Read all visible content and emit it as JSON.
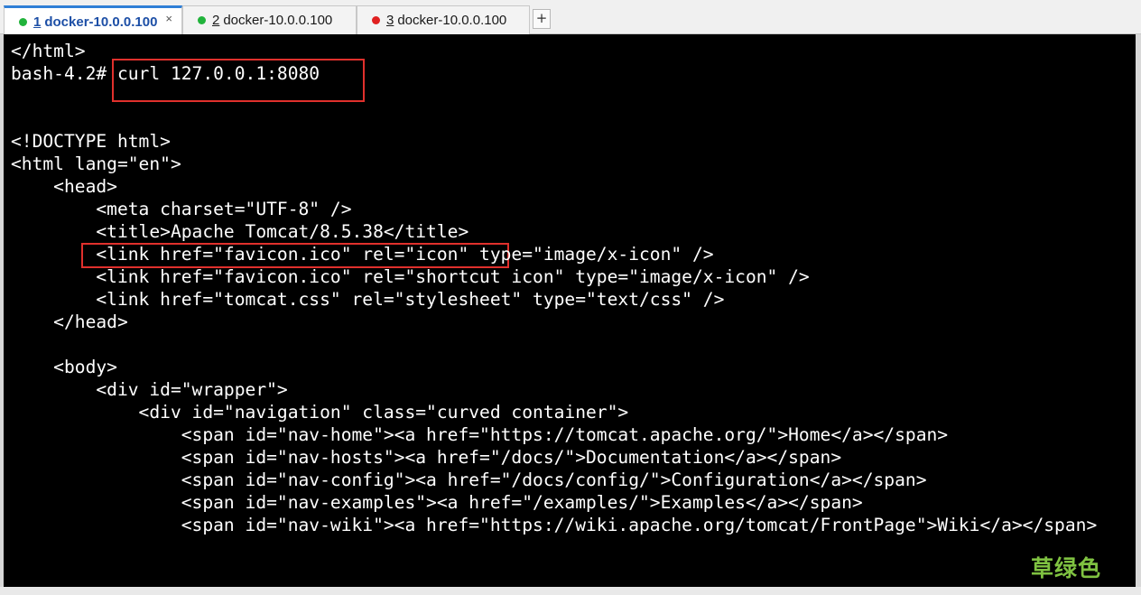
{
  "tabs": [
    {
      "num": "1",
      "label": "docker-10.0.0.100",
      "dot_color": "#21b33b",
      "active": true,
      "close": "×"
    },
    {
      "num": "2",
      "label": "docker-10.0.0.100",
      "dot_color": "#21b33b",
      "active": false
    },
    {
      "num": "3",
      "label": "docker-10.0.0.100",
      "dot_color": "#e02020",
      "active": false
    }
  ],
  "add_tab_label": "+",
  "terminal": {
    "lines": [
      "</html>",
      "bash-4.2# curl 127.0.0.1:8080",
      "",
      "",
      "<!DOCTYPE html>",
      "<html lang=\"en\">",
      "    <head>",
      "        <meta charset=\"UTF-8\" />",
      "        <title>Apache Tomcat/8.5.38</title>",
      "        <link href=\"favicon.ico\" rel=\"icon\" type=\"image/x-icon\" />",
      "        <link href=\"favicon.ico\" rel=\"shortcut icon\" type=\"image/x-icon\" />",
      "        <link href=\"tomcat.css\" rel=\"stylesheet\" type=\"text/css\" />",
      "    </head>",
      "",
      "    <body>",
      "        <div id=\"wrapper\">",
      "            <div id=\"navigation\" class=\"curved container\">",
      "                <span id=\"nav-home\"><a href=\"https://tomcat.apache.org/\">Home</a></span>",
      "                <span id=\"nav-hosts\"><a href=\"/docs/\">Documentation</a></span>",
      "                <span id=\"nav-config\"><a href=\"/docs/config/\">Configuration</a></span>",
      "                <span id=\"nav-examples\"><a href=\"/examples/\">Examples</a></span>",
      "                <span id=\"nav-wiki\"><a href=\"https://wiki.apache.org/tomcat/FrontPage\">Wiki</a></span>"
    ]
  },
  "highlight_color": "#e0302c",
  "watermark": "草绿色"
}
